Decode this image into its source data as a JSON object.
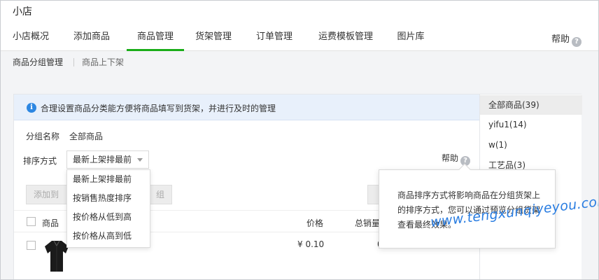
{
  "app": {
    "title": "小店"
  },
  "nav": {
    "tabs": [
      {
        "label": "小店概况"
      },
      {
        "label": "添加商品"
      },
      {
        "label": "商品管理",
        "active": true
      },
      {
        "label": "货架管理"
      },
      {
        "label": "订单管理"
      },
      {
        "label": "运费模板管理"
      },
      {
        "label": "图片库"
      }
    ],
    "help_label": "帮助",
    "active_color": "#1aad19"
  },
  "subnav": {
    "items": [
      {
        "label": "商品分组管理",
        "active": true
      },
      {
        "label": "商品上下架"
      }
    ]
  },
  "tip": {
    "icon": "info-icon",
    "text": "合理设置商品分类能方便将商品填写到货架，并进行及时的管理"
  },
  "group": {
    "label": "分组名称",
    "value": "全部商品"
  },
  "sort": {
    "label": "排序方式",
    "selected": "最新上架排最前",
    "options": [
      "最新上架排最前",
      "按销售热度排序",
      "按价格从低到高",
      "按价格从高到低"
    ],
    "help_label": "帮助"
  },
  "toolbar": {
    "add_to_label": "添加到",
    "group_btn_partial": "组"
  },
  "table": {
    "headers": {
      "product": "商品",
      "price": "价格",
      "sales": "总销量"
    },
    "rows": [
      {
        "price": "¥ 0.10",
        "sales": "0"
      }
    ]
  },
  "groups": {
    "items": [
      {
        "label": "全部商品(39)",
        "active": true
      },
      {
        "label": "yifu1(14)"
      },
      {
        "label": "w(1)"
      },
      {
        "label": "工艺品(3)"
      }
    ]
  },
  "popover": {
    "text": "商品排序方式将影响商品在分组货架上的排序方式，您可以通过预览分组货架查看最终效果。"
  },
  "watermark": {
    "text": "www.tengxunqiyeyou.com"
  }
}
